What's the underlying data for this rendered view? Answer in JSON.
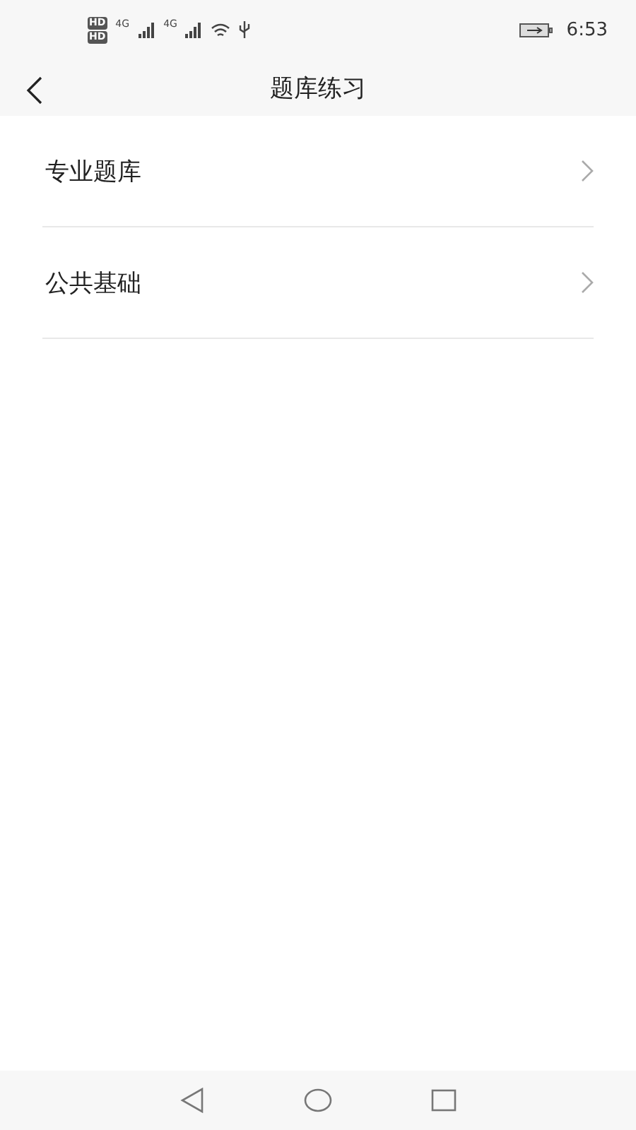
{
  "status_bar": {
    "sim_labels": [
      "HD",
      "HD"
    ],
    "network_labels": [
      "4G",
      "4G"
    ],
    "time": "6:53"
  },
  "header": {
    "title": "题库练习"
  },
  "items": [
    {
      "label": "专业题库"
    },
    {
      "label": "公共基础"
    }
  ]
}
